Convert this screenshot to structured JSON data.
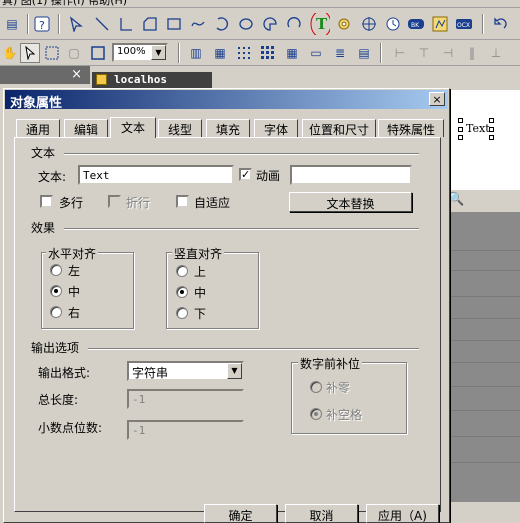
{
  "toolbar": {
    "zoom_value": "100%",
    "menu_fragment": "真)    图(1)    操作(I)    帮助(H)"
  },
  "background": {
    "tab_title": "localhos",
    "close_mark": "×",
    "preview_text": "Text"
  },
  "dialog": {
    "title": "对象属性",
    "close_glyph": "×",
    "tabs": [
      "通用",
      "编辑",
      "文本",
      "线型",
      "填充",
      "字体",
      "位置和尺寸",
      "特殊属性"
    ],
    "active_tab": "文本",
    "text_section": {
      "heading": "文本",
      "text_label": "文本:",
      "text_value": "Text",
      "animate_label": "动画",
      "animate_checked": true,
      "animate_value": "",
      "multiline_label": "多行",
      "multiline_checked": false,
      "wrap_label": "折行",
      "wrap_checked": false,
      "autofit_label": "自适应",
      "autofit_checked": false,
      "replace_button": "文本替换"
    },
    "effects": {
      "heading": "效果",
      "horizontal": {
        "label": "水平对齐",
        "options": [
          "左",
          "中",
          "右"
        ],
        "selected": "中"
      },
      "vertical": {
        "label": "竖直对齐",
        "options": [
          "上",
          "中",
          "下"
        ],
        "selected": "中"
      }
    },
    "output": {
      "heading": "输出选项",
      "format_label": "输出格式:",
      "format_value": "字符串",
      "total_length_label": "总长度:",
      "total_length_value": "-1",
      "decimals_label": "小数点位数:",
      "decimals_value": "-1",
      "padding_group": {
        "label": "数字前补位",
        "options": [
          "补零",
          "补空格"
        ],
        "selected": "补空格"
      }
    },
    "buttons": {
      "ok": "确定",
      "cancel": "取消",
      "apply": "应用（A)"
    }
  }
}
